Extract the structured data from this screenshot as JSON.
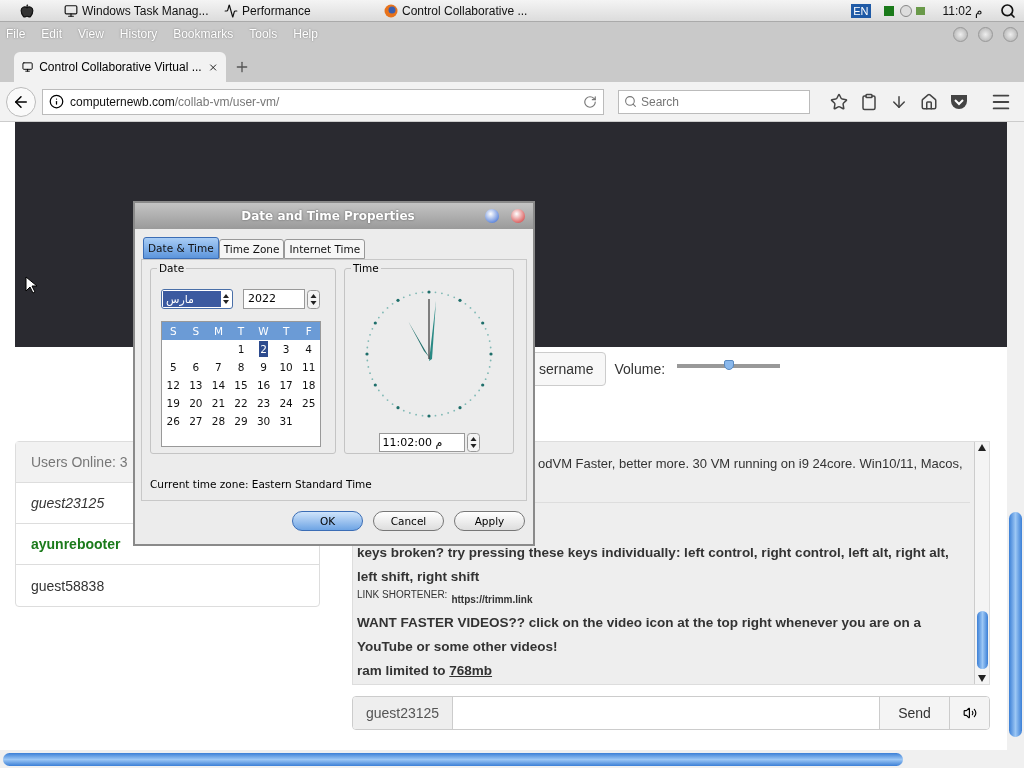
{
  "menubar": {
    "apps": [
      {
        "label": "Windows Task Manag...",
        "kind": "monitor"
      },
      {
        "label": "Performance",
        "kind": "chart"
      },
      {
        "label": "Control Collaborative ...",
        "kind": "browser"
      }
    ],
    "keyboard": "EN",
    "clock": "11:02 م"
  },
  "browser": {
    "menu": [
      "File",
      "Edit",
      "View",
      "History",
      "Bookmarks",
      "Tools",
      "Help"
    ],
    "tab": {
      "title": "Control Collaborative Virtual ...",
      "selected": true
    },
    "url": {
      "host": "computernewb.com",
      "path": "/collab-vm/user-vm/"
    },
    "search": {
      "placeholder": "Search"
    }
  },
  "vm_controls": {
    "username_button": "sername",
    "volume_label": "Volume:",
    "volume": {
      "level": 0.5
    }
  },
  "users": {
    "header": "Users Online: 3",
    "list": [
      {
        "name": "guest23125",
        "kind": "self"
      },
      {
        "name": "ayunrebooter",
        "kind": "admin"
      },
      {
        "name": "guest58838",
        "kind": "guest"
      }
    ]
  },
  "chat": {
    "messages": [
      {
        "kind": "plain",
        "text": "odVM Faster, better more. 30 VM running on i9 24core. Win10/11, Macos,"
      },
      {
        "kind": "bold",
        "text": "keys broken? try pressing these keys individually: left control, right control, left alt, right alt, left shift, right shift"
      },
      {
        "kind": "shortener",
        "label": "LINK SHORTENER:",
        "url": "https://trimm.link"
      },
      {
        "kind": "bold",
        "text": "WANT FASTER VIDEOS?? click on the video icon at the top right whenever you are on a YouTube or some other videos!"
      },
      {
        "kind": "bold",
        "text": "ram limited to",
        "link": "768mb"
      }
    ],
    "username": "guest23125",
    "send": "Send"
  },
  "dialog": {
    "title": "Date and Time Properties",
    "tabs": [
      {
        "label": "Date & Time",
        "selected": true
      },
      {
        "label": "Time Zone",
        "selected": false
      },
      {
        "label": "Internet Time",
        "selected": false
      }
    ],
    "date_label": "Date",
    "month": "مارس",
    "year": "2022",
    "weekdays": [
      "S",
      "S",
      "M",
      "T",
      "W",
      "T",
      "F"
    ],
    "days": [
      {
        "label": "1",
        "selected": false
      },
      {
        "label": "2",
        "selected": true
      },
      {
        "label": "3",
        "selected": false
      },
      {
        "label": "4",
        "selected": false
      },
      {
        "label": "5",
        "selected": false
      },
      {
        "label": "6",
        "selected": false
      },
      {
        "label": "7",
        "selected": false
      },
      {
        "label": "8",
        "selected": false
      },
      {
        "label": "9",
        "selected": false
      },
      {
        "label": "10",
        "selected": false
      },
      {
        "label": "11",
        "selected": false
      },
      {
        "label": "12",
        "selected": false
      },
      {
        "label": "13",
        "selected": false
      },
      {
        "label": "14",
        "selected": false
      },
      {
        "label": "15",
        "selected": false
      },
      {
        "label": "16",
        "selected": false
      },
      {
        "label": "17",
        "selected": false
      },
      {
        "label": "18",
        "selected": false
      },
      {
        "label": "19",
        "selected": false
      },
      {
        "label": "20",
        "selected": false
      },
      {
        "label": "21",
        "selected": false
      },
      {
        "label": "22",
        "selected": false
      },
      {
        "label": "23",
        "selected": false
      },
      {
        "label": "24",
        "selected": false
      },
      {
        "label": "25",
        "selected": false
      },
      {
        "label": "26",
        "selected": false
      },
      {
        "label": "27",
        "selected": false
      },
      {
        "label": "28",
        "selected": false
      },
      {
        "label": "29",
        "selected": false
      },
      {
        "label": "30",
        "selected": false
      },
      {
        "label": "31",
        "selected": false
      }
    ],
    "time_label": "Time",
    "time": "11:02:00 م",
    "timezone": "Current time zone:  Eastern Standard Time",
    "buttons": [
      {
        "label": "OK",
        "default": true
      },
      {
        "label": "Cancel",
        "default": false
      },
      {
        "label": "Apply",
        "default": false
      }
    ]
  }
}
